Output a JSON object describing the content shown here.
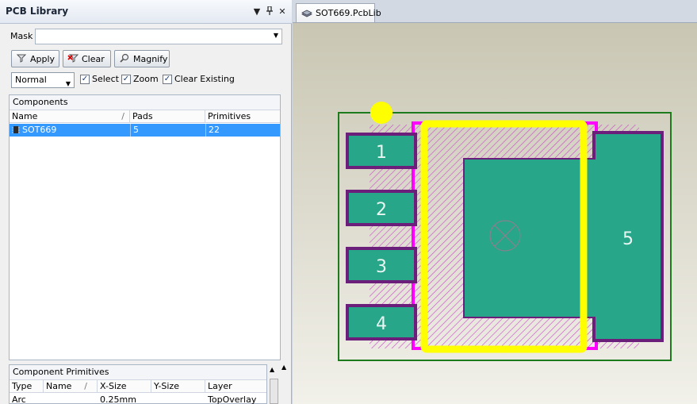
{
  "panel": {
    "title": "PCB Library",
    "controls": {
      "dropdown": "▼",
      "pin": "📌",
      "close": "✕"
    },
    "mask_label": "Mask",
    "mask_value": "",
    "buttons": {
      "apply": "Apply",
      "clear": "Clear",
      "magnify": "Magnify"
    },
    "mode": "Normal",
    "checkboxes": {
      "select": {
        "label": "Select",
        "checked": true
      },
      "zoom": {
        "label": "Zoom",
        "checked": true
      },
      "clear_existing": {
        "label": "Clear Existing",
        "checked": true
      }
    },
    "components": {
      "title": "Components",
      "columns": [
        "Name",
        "Pads",
        "Primitives"
      ],
      "sort_marker": "/",
      "rows": [
        {
          "name": "SOT669",
          "pads": "5",
          "primitives": "22"
        }
      ]
    },
    "primitives": {
      "title": "Component Primitives",
      "columns": [
        "Type",
        "Name",
        "X-Size",
        "Y-Size",
        "Layer"
      ],
      "sort_marker": "/",
      "rows": [
        {
          "type": "Arc",
          "name": "",
          "x_size": "0.25mm",
          "y_size": "",
          "layer": "TopOverlay"
        }
      ]
    }
  },
  "document": {
    "tab_label": "SOT669.PcbLib",
    "pads": [
      "1",
      "2",
      "3",
      "4",
      "5"
    ],
    "colors": {
      "canvas_bg_top": "#c9c6b3",
      "canvas_bg_bottom": "#f2f1ea",
      "pad_fill": "#27a68a",
      "pad_border": "#6b1f7a",
      "overlay": "#ffff00",
      "courtyard": "#ff00ff",
      "outline": "#1d7a1d",
      "body_hatch": "#cc44cc"
    }
  }
}
